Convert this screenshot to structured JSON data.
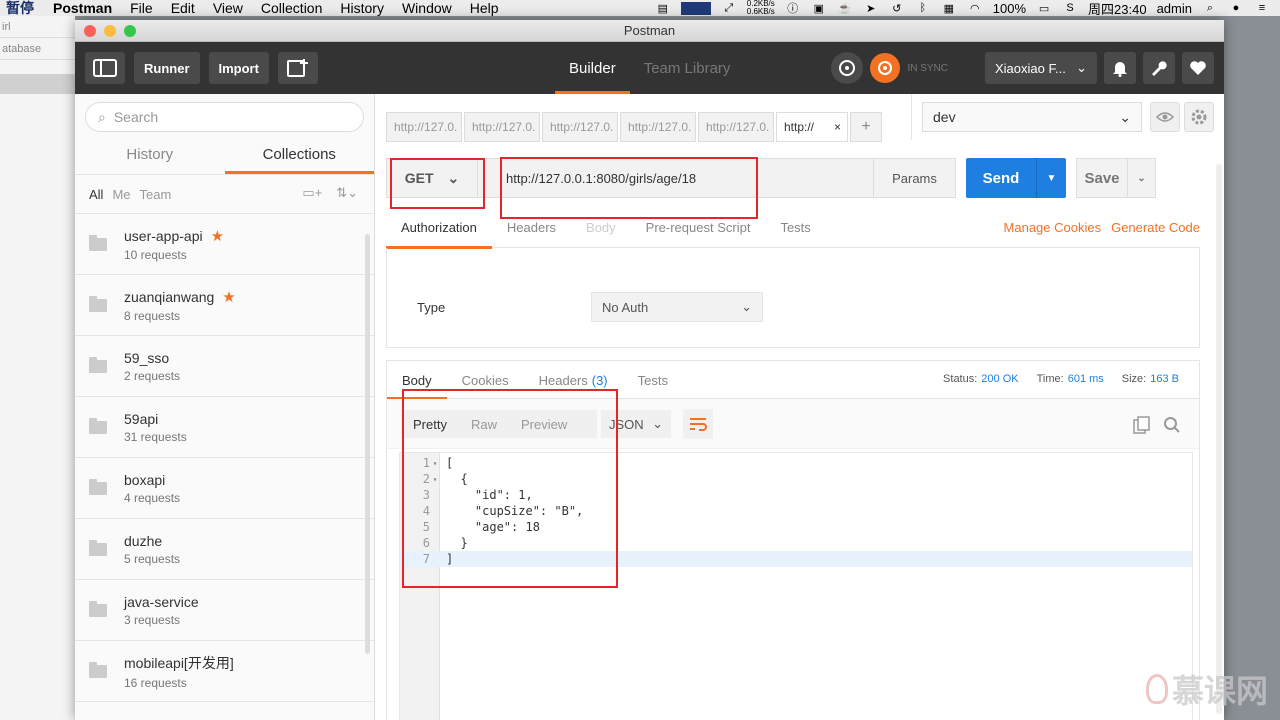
{
  "menubar": {
    "app": "Postman",
    "items": [
      "File",
      "Edit",
      "View",
      "Collection",
      "History",
      "Window",
      "Help"
    ],
    "net_up": "0.2KB/s",
    "net_down": "0.6KB/s",
    "battery": "100%",
    "clock": "周四23:40",
    "user": "admin",
    "apple_overlay": "暂停"
  },
  "desktop_left": {
    "rows": [
      "irl",
      "atabase"
    ]
  },
  "window": {
    "title": "Postman"
  },
  "toolbar": {
    "runner_label": "Runner",
    "import_label": "Import",
    "tab_builder": "Builder",
    "tab_team_library": "Team Library",
    "sync_label": "IN SYNC",
    "user_label": "Xiaoxiao F..."
  },
  "sidebar": {
    "search_placeholder": "Search",
    "tab_history": "History",
    "tab_collections": "Collections",
    "filter_all": "All",
    "filter_me": "Me",
    "filter_team": "Team",
    "collections": [
      {
        "name": "user-app-api",
        "count": "10 requests",
        "starred": true
      },
      {
        "name": "zuanqianwang",
        "count": "8 requests",
        "starred": true
      },
      {
        "name": "59_sso",
        "count": "2 requests",
        "starred": false
      },
      {
        "name": "59api",
        "count": "31 requests",
        "starred": false
      },
      {
        "name": "boxapi",
        "count": "4 requests",
        "starred": false
      },
      {
        "name": "duzhe",
        "count": "5 requests",
        "starred": false
      },
      {
        "name": "java-service",
        "count": "3 requests",
        "starred": false
      },
      {
        "name": "mobileapi[开发用]",
        "count": "16 requests",
        "starred": false
      }
    ]
  },
  "request_tabs": {
    "tabs": [
      "http://127.0.",
      "http://127.0.",
      "http://127.0.",
      "http://127.0.",
      "http://127.0.",
      "http://"
    ],
    "close": "×",
    "add": "+"
  },
  "environment": {
    "selected": "dev"
  },
  "request": {
    "method": "GET",
    "url": "http://127.0.0.1:8080/girls/age/18",
    "params_label": "Params",
    "send_label": "Send",
    "save_label": "Save"
  },
  "request_subtabs": {
    "tabs": [
      "Authorization",
      "Headers",
      "Body",
      "Pre-request Script",
      "Tests"
    ],
    "manage_cookies": "Manage Cookies",
    "generate_code": "Generate Code"
  },
  "auth": {
    "type_label": "Type",
    "type_value": "No Auth"
  },
  "response": {
    "tabs": [
      "Body",
      "Cookies",
      "Headers",
      "Tests"
    ],
    "headers_count": "(3)",
    "status_label": "Status:",
    "status_value": "200 OK",
    "time_label": "Time:",
    "time_value": "601 ms",
    "size_label": "Size:",
    "size_value": "163 B",
    "view_pretty": "Pretty",
    "view_raw": "Raw",
    "view_preview": "Preview",
    "format": "JSON",
    "code_lines": [
      {
        "n": "1",
        "fold": "▾",
        "text": "["
      },
      {
        "n": "2",
        "fold": "▾",
        "text": "  {"
      },
      {
        "n": "3",
        "fold": "",
        "text": "    \"id\": 1,"
      },
      {
        "n": "4",
        "fold": "",
        "text": "    \"cupSize\": \"B\","
      },
      {
        "n": "5",
        "fold": "",
        "text": "    \"age\": 18"
      },
      {
        "n": "6",
        "fold": "",
        "text": "  }"
      },
      {
        "n": "7",
        "fold": "",
        "text": "]"
      }
    ]
  },
  "watermark": "慕课网",
  "colors": {
    "accent": "#f47023",
    "send_blue": "#1f7fe0",
    "highlight_red": "#e3262a",
    "toolbar_dark": "#333333"
  }
}
